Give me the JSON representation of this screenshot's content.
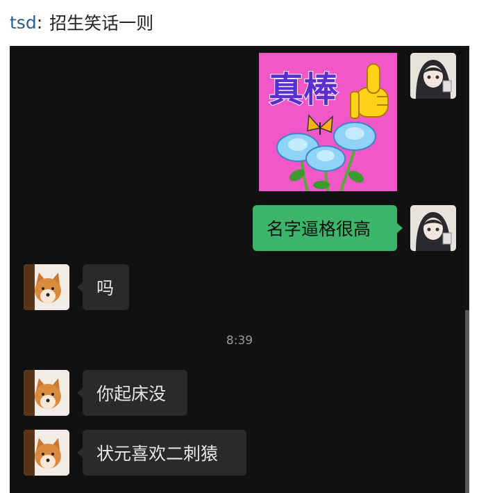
{
  "post": {
    "author": "tsd",
    "separator": ":",
    "title": "招生笑话一则"
  },
  "chat": {
    "messages": [
      {
        "side": "out",
        "type": "sticker",
        "sticker_text": "真棒"
      },
      {
        "side": "out",
        "type": "text",
        "text": "名字逼格很高"
      },
      {
        "side": "in",
        "type": "text",
        "text": "吗"
      },
      {
        "type": "time",
        "text": "8:39"
      },
      {
        "side": "in",
        "type": "text",
        "text": "你起床没"
      },
      {
        "side": "in",
        "type": "text",
        "text": "状元喜欢二刺猿"
      }
    ]
  },
  "colors": {
    "chat_bg": "#111111",
    "outgoing_bubble": "#3cb46a",
    "incoming_bubble": "#2a2a2a",
    "sticker_bg": "#f157c8",
    "author_link": "#2b5f8a"
  },
  "icons": {
    "self_avatar": "anime-girl-avatar",
    "other_avatar": "shiba-dog-avatar",
    "sticker_thumb": "thumbs-up-icon",
    "sticker_butterfly": "butterfly-icon",
    "sticker_flowers": "blue-roses-icon"
  }
}
